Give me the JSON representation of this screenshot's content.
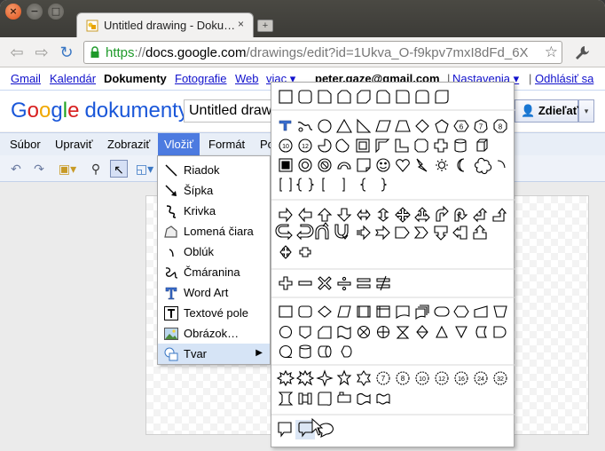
{
  "browser": {
    "tab_title": "Untitled drawing - Doku…",
    "tab_close": "×",
    "new_tab": "+",
    "url_scheme": "https",
    "url_host": "docs.google.com",
    "url_path": "/drawings/edit?id=1Ukva_O-f9kpv7mxI8dFd_6X"
  },
  "gbar": {
    "links": [
      "Gmail",
      "Kalendár",
      "Fotografie",
      "Web",
      "viac ▾"
    ],
    "current": "Dokumenty",
    "account": "peter.gaze@gmail.com",
    "separator": "|",
    "settings": "Nastavenia ▾",
    "signout": "Odhlásiť sa"
  },
  "docs": {
    "logo_letters": [
      "G",
      "o",
      "o",
      "g",
      "l",
      "e"
    ],
    "product": "dokumenty",
    "doc_title": "Untitled drawing",
    "share_label": "Zdieľať",
    "share_dropdown": "▾"
  },
  "menubar": [
    "Súbor",
    "Upraviť",
    "Zobraziť",
    "Vložiť",
    "Formát",
    "Po"
  ],
  "insert_menu": {
    "items": [
      {
        "label": "Riadok",
        "icon": "line-icon"
      },
      {
        "label": "Šípka",
        "icon": "arrow-icon"
      },
      {
        "label": "Krivka",
        "icon": "curve-icon"
      },
      {
        "label": "Lomená čiara",
        "icon": "polyline-icon"
      },
      {
        "label": "Oblúk",
        "icon": "arc-icon"
      },
      {
        "label": "Čmáranina",
        "icon": "scribble-icon"
      },
      {
        "label": "Word Art",
        "icon": "wordart-icon"
      },
      {
        "label": "Textové pole",
        "icon": "textbox-icon"
      },
      {
        "label": "Obrázok…",
        "icon": "image-icon"
      },
      {
        "label": "Tvar",
        "icon": "shape-icon",
        "submenu_arrow": "▶"
      }
    ]
  },
  "shapes_panel": {
    "star_labels": [
      "4",
      "5",
      "6",
      "7",
      "8",
      "10",
      "12",
      "16",
      "24",
      "32"
    ],
    "octagon_labels": [
      "6",
      "7",
      "8"
    ],
    "circle_labels": [
      "10",
      "12"
    ]
  }
}
